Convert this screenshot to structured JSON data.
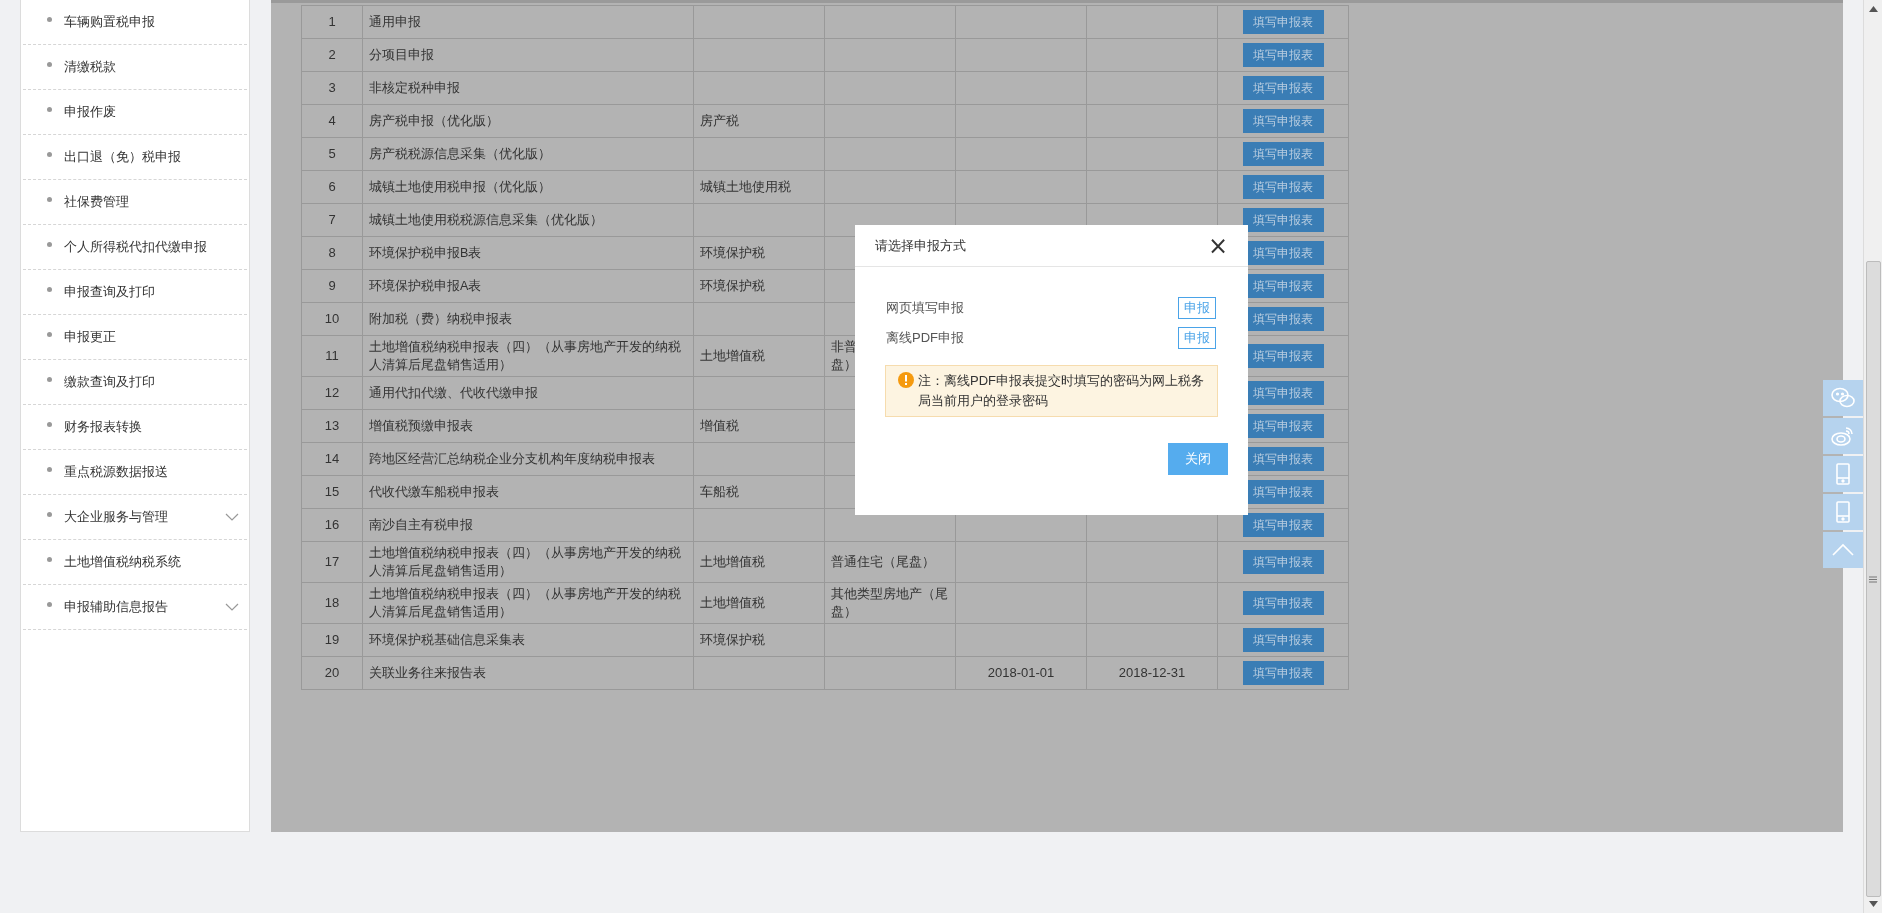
{
  "sidebar": {
    "items": [
      {
        "label": "车辆购置税申报",
        "kind": "link"
      },
      {
        "label": "清缴税款",
        "kind": "link"
      },
      {
        "label": "申报作废",
        "kind": "link"
      },
      {
        "label": "出口退（免）税申报",
        "kind": "link"
      },
      {
        "label": "社保费管理",
        "kind": "link"
      },
      {
        "label": "个人所得税代扣代缴申报",
        "kind": "link"
      },
      {
        "label": "申报查询及打印",
        "kind": "link"
      },
      {
        "label": "申报更正",
        "kind": "link"
      },
      {
        "label": "缴款查询及打印",
        "kind": "link"
      },
      {
        "label": "财务报表转换",
        "kind": "link"
      },
      {
        "label": "重点税源数据报送",
        "kind": "link"
      },
      {
        "label": "大企业服务与管理",
        "kind": "group"
      },
      {
        "label": "土地增值税纳税系统",
        "kind": "link"
      },
      {
        "label": "申报辅助信息报告",
        "kind": "group"
      }
    ]
  },
  "table": {
    "rows": [
      {
        "no": "1",
        "name": "通用申报",
        "action": "填写申报表"
      },
      {
        "no": "2",
        "name": "分项目申报",
        "action": "填写申报表"
      },
      {
        "no": "3",
        "name": "非核定税种申报",
        "action": "填写申报表"
      },
      {
        "no": "4",
        "name": "房产税申报（优化版）",
        "tax": "房产税",
        "action": "填写申报表"
      },
      {
        "no": "5",
        "name": "房产税税源信息采集（优化版）",
        "action": "填写申报表"
      },
      {
        "no": "6",
        "name": "城镇土地使用税申报（优化版）",
        "tax": "城镇土地使用税",
        "action": "填写申报表"
      },
      {
        "no": "7",
        "name": "城镇土地使用税税源信息采集（优化版）",
        "action": "填写申报表"
      },
      {
        "no": "8",
        "name": "环境保护税申报B表",
        "tax": "环境保护税",
        "action": "填写申报表"
      },
      {
        "no": "9",
        "name": "环境保护税申报A表",
        "tax": "环境保护税",
        "action": "填写申报表"
      },
      {
        "no": "10",
        "name": "附加税（费）纳税申报表",
        "action": "填写申报表"
      },
      {
        "no": "11",
        "name": "土地增值税纳税申报表（四）（从事房地产开发的纳税人清算后尾盘销售适用）",
        "tax": "土地增值税",
        "column_4": [
          "非普",
          "盘）"
        ],
        "action": "填写申报表"
      },
      {
        "no": "12",
        "name": "通用代扣代缴、代收代缴申报",
        "action": "填写申报表"
      },
      {
        "no": "13",
        "name": "增值税预缴申报表",
        "tax": "增值税",
        "action": "填写申报表"
      },
      {
        "no": "14",
        "name": "跨地区经营汇总纳税企业分支机构年度纳税申报表",
        "action": "填写申报表"
      },
      {
        "no": "15",
        "name": "代收代缴车船税申报表",
        "tax": "车船税",
        "action": "填写申报表"
      },
      {
        "no": "16",
        "name": "南沙自主有税申报",
        "action": "填写申报表"
      },
      {
        "no": "17",
        "name": "土地增值税纳税申报表（四）（从事房地产开发的纳税人清算后尾盘销售适用）",
        "tax": "土地增值税",
        "column_4": "普通住宅（尾盘）",
        "action": "填写申报表"
      },
      {
        "no": "18",
        "name": "土地增值税纳税申报表（四）（从事房地产开发的纳税人清算后尾盘销售适用）",
        "tax": "土地增值税",
        "column_4": "其他类型房地产（尾盘）",
        "action": "填写申报表"
      },
      {
        "no": "19",
        "name": "环境保护税基础信息采集表",
        "tax": "环境保护税",
        "action": "填写申报表"
      },
      {
        "no": "20",
        "name": "关联业务往来报告表",
        "start": "2018-01-01",
        "end": "2018-12-31",
        "action": "填写申报表"
      }
    ]
  },
  "dialog": {
    "title": "请选择申报方式",
    "close": "×",
    "options": [
      {
        "label": "网页填写申报",
        "button": "申报"
      },
      {
        "label": "离线PDF申报",
        "button": "申报"
      }
    ],
    "note": "注：离线PDF申报表提交时填写的密码为网上税务局当前用户的登录密码",
    "close_button": "关闭"
  },
  "float_bar": {
    "items": [
      {
        "kind": "chat"
      },
      {
        "kind": "weibo"
      },
      {
        "kind": "phone"
      },
      {
        "kind": "tablet"
      },
      {
        "kind": "top"
      }
    ]
  }
}
